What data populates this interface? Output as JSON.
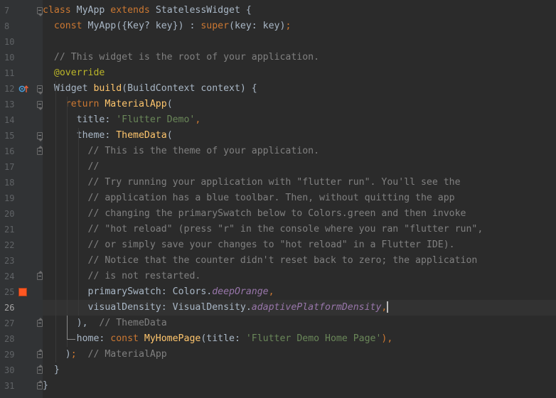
{
  "editor": {
    "language": "dart",
    "current_line": 26,
    "lines": [
      {
        "n": "7",
        "tokens": [
          {
            "t": "class ",
            "c": "kw"
          },
          {
            "t": "MyApp ",
            "c": "cls"
          },
          {
            "t": "extends ",
            "c": "kw"
          },
          {
            "t": "StatelessWidget {",
            "c": "cls"
          }
        ]
      },
      {
        "n": "8",
        "tokens": [
          {
            "t": "  "
          },
          {
            "t": "const ",
            "c": "kw"
          },
          {
            "t": "MyApp({Key? key}) : ",
            "c": "cls"
          },
          {
            "t": "super",
            "c": "kw"
          },
          {
            "t": "(key: key)",
            "c": "cls"
          },
          {
            "t": ";",
            "c": "kw"
          }
        ]
      },
      {
        "n": "10",
        "tokens": []
      },
      {
        "n": "10",
        "tokens": [
          {
            "t": "  "
          },
          {
            "t": "// This widget is the root of your application.",
            "c": "cmt"
          }
        ]
      },
      {
        "n": "11",
        "tokens": [
          {
            "t": "  "
          },
          {
            "t": "@override",
            "c": "ann"
          }
        ]
      },
      {
        "n": "12",
        "tokens": [
          {
            "t": "  "
          },
          {
            "t": "Widget ",
            "c": "cls"
          },
          {
            "t": "build",
            "c": "fn"
          },
          {
            "t": "(BuildContext context) {",
            "c": "cls"
          }
        ]
      },
      {
        "n": "13",
        "tokens": [
          {
            "t": "    "
          },
          {
            "t": "return ",
            "c": "kw"
          },
          {
            "t": "MaterialApp",
            "c": "fn"
          },
          {
            "t": "(",
            "c": "cls"
          }
        ]
      },
      {
        "n": "14",
        "tokens": [
          {
            "t": "      "
          },
          {
            "t": "title: ",
            "c": "cls"
          },
          {
            "t": "'Flutter Demo'",
            "c": "str"
          },
          {
            "t": ",",
            "c": "kw"
          }
        ]
      },
      {
        "n": "15",
        "tokens": [
          {
            "t": "      "
          },
          {
            "t": "theme: ",
            "c": "cls"
          },
          {
            "t": "ThemeData",
            "c": "fn"
          },
          {
            "t": "(",
            "c": "cls"
          }
        ]
      },
      {
        "n": "16",
        "tokens": [
          {
            "t": "        "
          },
          {
            "t": "// This is the theme of your application.",
            "c": "cmt"
          }
        ]
      },
      {
        "n": "17",
        "tokens": [
          {
            "t": "        "
          },
          {
            "t": "//",
            "c": "cmt"
          }
        ]
      },
      {
        "n": "18",
        "tokens": [
          {
            "t": "        "
          },
          {
            "t": "// Try running your application with \"flutter run\". You'll see the",
            "c": "cmt"
          }
        ]
      },
      {
        "n": "19",
        "tokens": [
          {
            "t": "        "
          },
          {
            "t": "// application has a blue toolbar. Then, without quitting the app",
            "c": "cmt"
          }
        ]
      },
      {
        "n": "20",
        "tokens": [
          {
            "t": "        "
          },
          {
            "t": "// changing the primarySwatch below to Colors.green and then invoke",
            "c": "cmt"
          }
        ]
      },
      {
        "n": "21",
        "tokens": [
          {
            "t": "        "
          },
          {
            "t": "// \"hot reload\" (press \"r\" in the console where you ran \"flutter run\",",
            "c": "cmt"
          }
        ]
      },
      {
        "n": "22",
        "tokens": [
          {
            "t": "        "
          },
          {
            "t": "// or simply save your changes to \"hot reload\" in a Flutter IDE).",
            "c": "cmt"
          }
        ]
      },
      {
        "n": "23",
        "tokens": [
          {
            "t": "        "
          },
          {
            "t": "// Notice that the counter didn't reset back to zero; the application",
            "c": "cmt"
          }
        ]
      },
      {
        "n": "24",
        "tokens": [
          {
            "t": "        "
          },
          {
            "t": "// is not restarted.",
            "c": "cmt"
          }
        ]
      },
      {
        "n": "25",
        "tokens": [
          {
            "t": "        "
          },
          {
            "t": "primarySwatch: Colors.",
            "c": "cls"
          },
          {
            "t": "deepOrange",
            "c": "fld"
          },
          {
            "t": ",",
            "c": "kw"
          }
        ]
      },
      {
        "n": "26",
        "tokens": [
          {
            "t": "        "
          },
          {
            "t": "visualDensity: VisualDensity.",
            "c": "cls"
          },
          {
            "t": "adaptivePlatformDensity",
            "c": "fld"
          },
          {
            "t": ",",
            "c": "kw"
          }
        ]
      },
      {
        "n": "27",
        "tokens": [
          {
            "t": "      "
          },
          {
            "t": "),  ",
            "c": "cls"
          },
          {
            "t": "// ThemeData",
            "c": "cmt"
          }
        ]
      },
      {
        "n": "28",
        "tokens": [
          {
            "t": "      "
          },
          {
            "t": "home: ",
            "c": "cls"
          },
          {
            "t": "const ",
            "c": "kw"
          },
          {
            "t": "MyHomePage",
            "c": "fn"
          },
          {
            "t": "(title: ",
            "c": "cls"
          },
          {
            "t": "'Flutter Demo Home Page'",
            "c": "str"
          },
          {
            "t": "),",
            "c": "kw"
          }
        ]
      },
      {
        "n": "29",
        "tokens": [
          {
            "t": "    "
          },
          {
            "t": ")",
            "c": "cls"
          },
          {
            "t": ";  ",
            "c": "kw"
          },
          {
            "t": "// MaterialApp",
            "c": "cmt"
          }
        ]
      },
      {
        "n": "30",
        "tokens": [
          {
            "t": "  "
          },
          {
            "t": "}",
            "c": "cls"
          }
        ]
      },
      {
        "n": "31",
        "tokens": [
          {
            "t": "}",
            "c": "cls"
          }
        ]
      }
    ],
    "gutter_markers": {
      "override_line": "12",
      "color_swatch_line": "25",
      "color_swatch_hex": "#ff5722",
      "fold_top_lines": [
        "7",
        "12",
        "13",
        "15"
      ],
      "fold_end_lines": [
        "16",
        "24",
        "27",
        "29",
        "30",
        "31"
      ]
    },
    "colors": {
      "background": "#2b2b2b",
      "gutter": "#313335",
      "keyword": "#cc7832",
      "function": "#ffc66d",
      "string": "#6a8759",
      "comment": "#808080",
      "annotation": "#bbb529",
      "field": "#9876aa",
      "text": "#a9b7c6"
    }
  }
}
